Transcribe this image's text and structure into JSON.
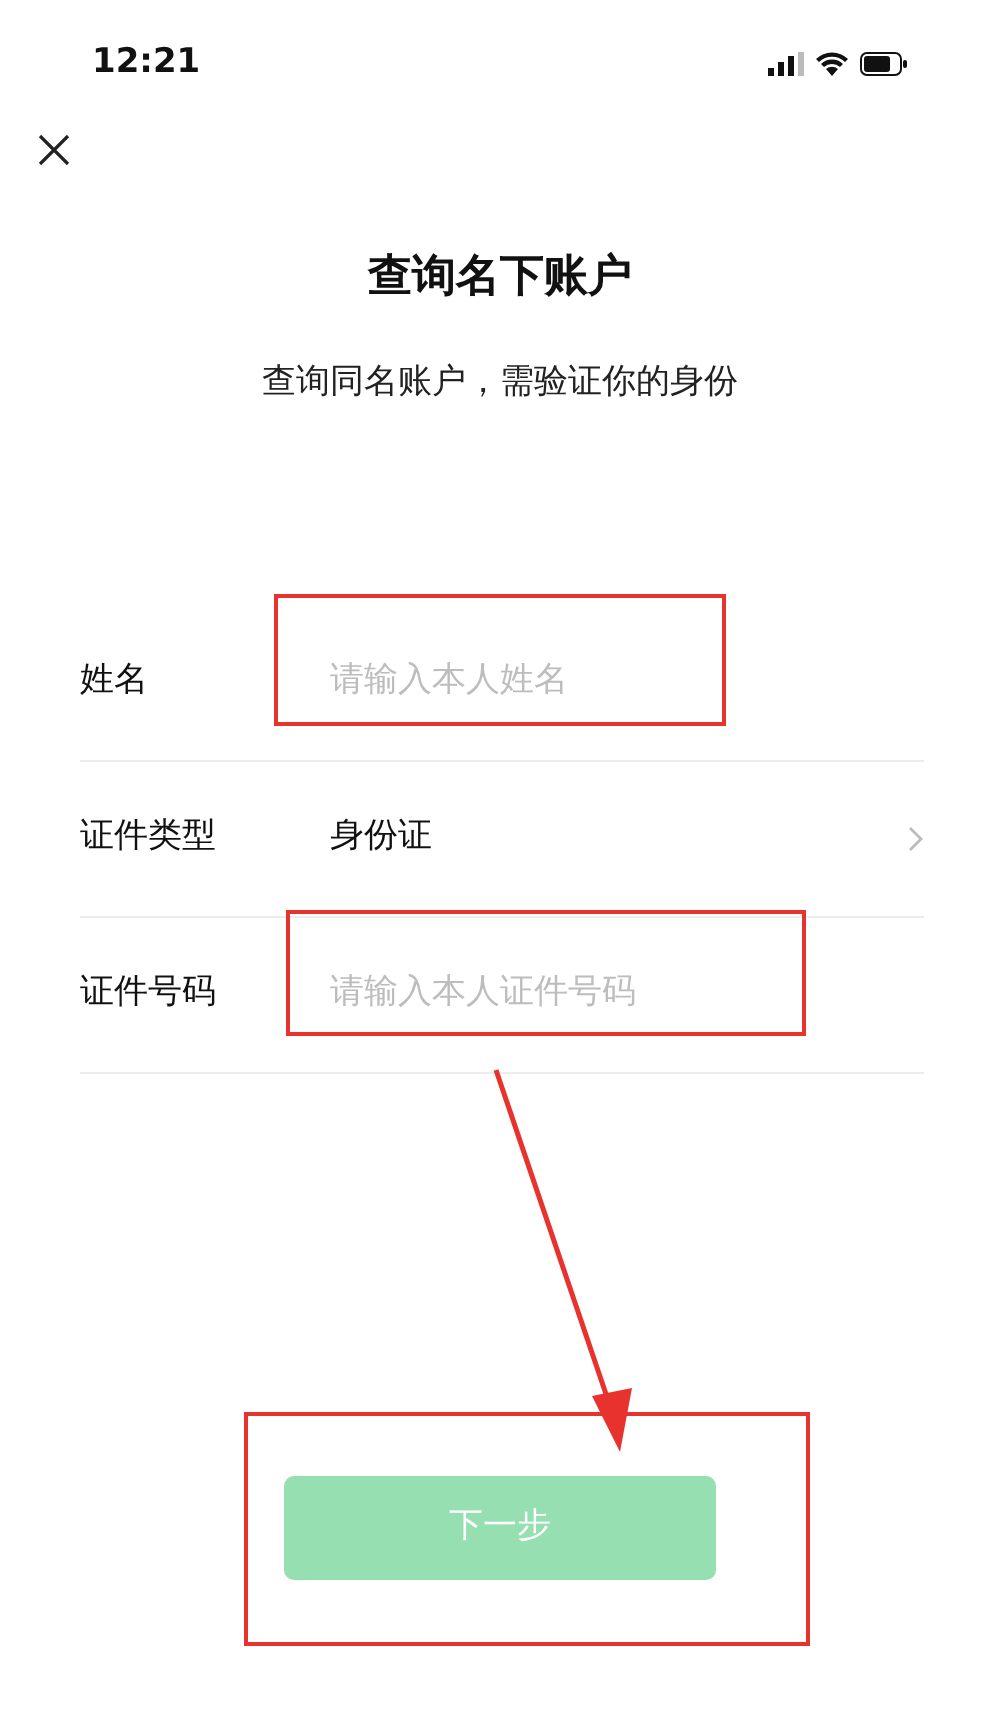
{
  "status_bar": {
    "time": "12:21"
  },
  "title": "查询名下账户",
  "subtitle": "查询同名账户，需验证你的身份",
  "fields": [
    {
      "kind": "input",
      "label": "姓名",
      "placeholder": "请输入本人姓名"
    },
    {
      "kind": "select",
      "label": "证件类型",
      "value": "身份证"
    },
    {
      "kind": "input",
      "label": "证件号码",
      "placeholder": "请输入本人证件号码"
    }
  ],
  "next_button": {
    "label": "下一步",
    "disabled": true
  }
}
